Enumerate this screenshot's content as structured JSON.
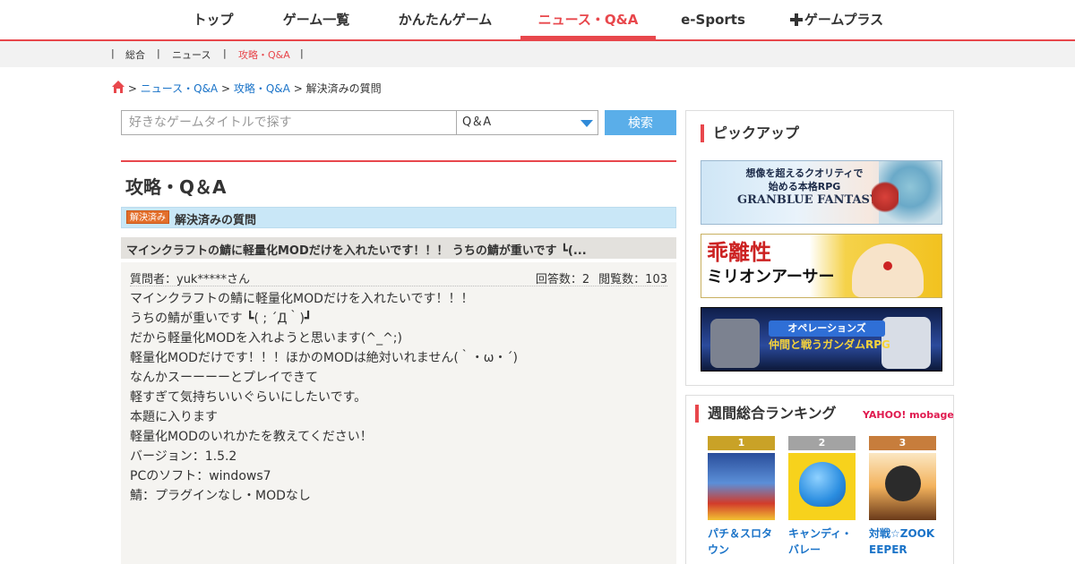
{
  "topnav": {
    "items": [
      "トップ",
      "ゲーム一覧",
      "かんたんゲーム",
      "ニュース・Q&A",
      "e-Sports",
      "ゲームプラス"
    ],
    "active_index": 3
  },
  "subnav": {
    "items": [
      "総合",
      "ニュース",
      "攻略・Q&A"
    ],
    "separator": "|",
    "active_index": 2
  },
  "breadcrumb": {
    "links": [
      "ニュース・Q&A",
      "攻略・Q&A"
    ],
    "current": "解決済みの質問",
    "sep": ">"
  },
  "search": {
    "placeholder": "好きなゲームタイトルで探す",
    "select_value": "Q＆A",
    "button": "検索"
  },
  "main": {
    "title": "攻略・Q＆A",
    "solved_badge": "解決済み",
    "solved_label": "解決済みの質問",
    "question_title": "マインクラフトの鯖に軽量化MODだけを入れたいです！！！ うちの鯖が重いです ┗(...",
    "asker": "質問者：yuk*****さん",
    "answers": "回答数：2",
    "views": "閲覧数：103",
    "body_lines": [
      "マインクラフトの鯖に軽量化MODだけを入れたいです！！！",
      "うちの鯖が重いです ┗( ; ´Д｀)┛",
      "だから軽量化MODを入れようと思います(^_^;)",
      "軽量化MODだけです！！！ほかのMODは絶対いれません(｀・ω・´)",
      "なんかスーーーーとプレイできて",
      "軽すぎて気持ちいいぐらいにしたいです。",
      "本題に入ります",
      "軽量化MODのいれかたを教えてください！",
      "バージョン：1.5.2",
      "PCのソフト：windows7",
      "鯖：プラグインなし・MODなし"
    ]
  },
  "sidebar": {
    "pickup_title": "ピックアップ",
    "banners": [
      {
        "line1": "想像を超えるクオリティで",
        "line2": "始める本格RPG",
        "line3": "GRANBLUE FANTASY"
      },
      {
        "line1": "乖離性",
        "line2": "ミリオンアーサー"
      },
      {
        "line1": "オペレーションズ",
        "line2": "仲間と戦うガンダムRPG"
      }
    ],
    "ranking_title": "週間総合ランキング",
    "ranking_logo": "YAHOO! mobage",
    "ranking": [
      {
        "rank": "1",
        "name": "パチ＆スロタウン",
        "color": "#c9a227"
      },
      {
        "rank": "2",
        "name": "キャンディ・バレー",
        "color": "#a3a3a3"
      },
      {
        "rank": "3",
        "name": "対戦☆ZOOKEEPER",
        "color": "#c77d3c"
      }
    ]
  },
  "colors": {
    "accent": "#e8474c",
    "link": "#1a73c8",
    "search_button": "#5aaee9"
  }
}
